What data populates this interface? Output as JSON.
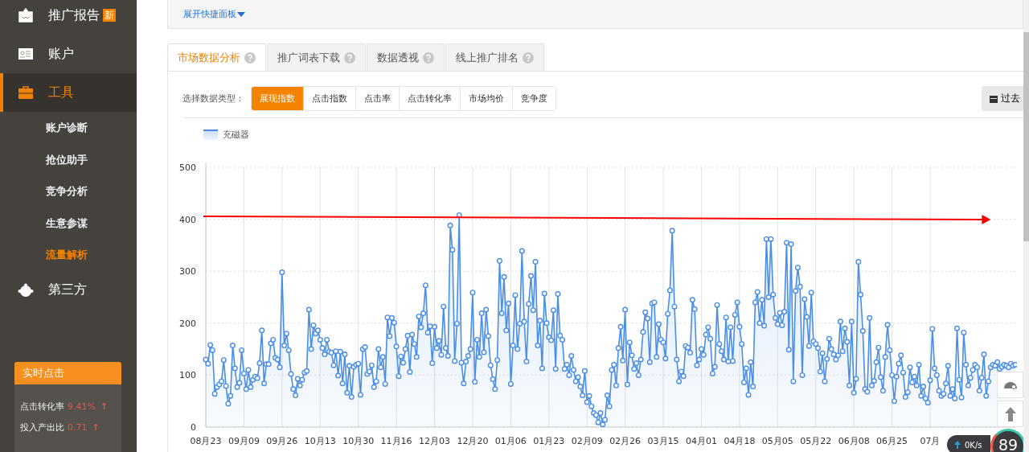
{
  "sidebar": {
    "items": [
      {
        "label": "推广报告",
        "badge": "新",
        "selected": false
      },
      {
        "label": "账户",
        "selected": false
      },
      {
        "label": "工具",
        "selected": true,
        "children": [
          {
            "label": "账户诊断",
            "selected": false
          },
          {
            "label": "抢位助手",
            "selected": false
          },
          {
            "label": "竞争分析",
            "selected": false
          },
          {
            "label": "生意参谋",
            "selected": false
          },
          {
            "label": "流量解析",
            "selected": true
          }
        ]
      },
      {
        "label": "第三方",
        "selected": false
      }
    ],
    "realtime": {
      "title": "实时点击",
      "rows": [
        {
          "label": "点击转化率",
          "value": "9.41%",
          "trend": "↑"
        },
        {
          "label": "投入产出比",
          "value": "0.71",
          "trend": "↑"
        }
      ]
    }
  },
  "quick_panel": {
    "label": "展开快捷面板"
  },
  "tabs": [
    {
      "label": "市场数据分析",
      "selected": true
    },
    {
      "label": "推广词表下载",
      "selected": false
    },
    {
      "label": "数据透视",
      "selected": false
    },
    {
      "label": "线上推广排名",
      "selected": false
    }
  ],
  "data_type": {
    "label": "选择数据类型：",
    "options": [
      {
        "label": "展现指数",
        "selected": true
      },
      {
        "label": "点击指数",
        "selected": false
      },
      {
        "label": "点击率",
        "selected": false
      },
      {
        "label": "点击转化率",
        "selected": false
      },
      {
        "label": "市场均价",
        "selected": false
      },
      {
        "label": "竞争度",
        "selected": false
      }
    ]
  },
  "date_button": {
    "label": "过去"
  },
  "chart": {
    "chart_data": {
      "type": "area",
      "grid": true,
      "ylim": [
        0,
        500
      ],
      "yticks": [
        0,
        100,
        200,
        300,
        400,
        500
      ],
      "categories": [
        "08月23",
        null,
        null,
        null,
        null,
        null,
        null,
        null,
        null,
        null,
        null,
        null,
        null,
        null,
        null,
        null,
        null,
        "09月09",
        null,
        null,
        null,
        null,
        null,
        null,
        null,
        null,
        null,
        null,
        null,
        null,
        null,
        null,
        null,
        null,
        "09月26",
        null,
        null,
        null,
        null,
        null,
        null,
        null,
        null,
        null,
        null,
        null,
        null,
        null,
        null,
        null,
        null,
        "10月13",
        null,
        null,
        null,
        null,
        null,
        null,
        null,
        null,
        null,
        null,
        null,
        null,
        null,
        null,
        null,
        null,
        "10月30",
        null,
        null,
        null,
        null,
        null,
        null,
        null,
        null,
        null,
        null,
        null,
        null,
        null,
        null,
        null,
        null,
        "11月16",
        null,
        null,
        null,
        null,
        null,
        null,
        null,
        null,
        null,
        null,
        null,
        null,
        null,
        null,
        null,
        null,
        "12月03",
        null,
        null,
        null,
        null,
        null,
        null,
        null,
        null,
        null,
        null,
        null,
        null,
        null,
        null,
        null,
        null,
        "12月20",
        null,
        null,
        null,
        null,
        null,
        null,
        null,
        null,
        null,
        null,
        null,
        null,
        null,
        null,
        null,
        null,
        "01月06",
        null,
        null,
        null,
        null,
        null,
        null,
        null,
        null,
        null,
        null,
        null,
        null,
        null,
        null,
        null,
        null,
        "01月23",
        null,
        null,
        null,
        null,
        null,
        null,
        null,
        null,
        null,
        null,
        null,
        null,
        null,
        null,
        null,
        null,
        "02月09",
        null,
        null,
        null,
        null,
        null,
        null,
        null,
        null,
        null,
        null,
        null,
        null,
        null,
        null,
        null,
        null,
        "02月26",
        null,
        null,
        null,
        null,
        null,
        null,
        null,
        null,
        null,
        null,
        null,
        null,
        null,
        null,
        null,
        null,
        "03月15",
        null,
        null,
        null,
        null,
        null,
        null,
        null,
        null,
        null,
        null,
        null,
        null,
        null,
        null,
        null,
        null,
        "04月01",
        null,
        null,
        null,
        null,
        null,
        null,
        null,
        null,
        null,
        null,
        null,
        null,
        null,
        null,
        null,
        null,
        "04月18",
        null,
        null,
        null,
        null,
        null,
        null,
        null,
        null,
        null,
        null,
        null,
        null,
        null,
        null,
        null,
        null,
        "05月05",
        null,
        null,
        null,
        null,
        null,
        null,
        null,
        null,
        null,
        null,
        null,
        null,
        null,
        null,
        null,
        null,
        "05月22",
        null,
        null,
        null,
        null,
        null,
        null,
        null,
        null,
        null,
        null,
        null,
        null,
        null,
        null,
        null,
        null,
        "06月08",
        null,
        null,
        null,
        null,
        null,
        null,
        null,
        null,
        null,
        null,
        null,
        null,
        null,
        null,
        null,
        null,
        "06月25",
        null,
        null,
        null,
        null,
        null,
        null,
        null,
        null,
        null,
        null,
        null,
        null,
        null,
        null,
        null,
        null,
        "07月",
        null,
        null,
        null,
        null,
        null,
        null,
        null,
        null,
        null,
        null,
        null,
        null,
        null,
        null,
        null,
        null,
        null,
        null,
        null,
        null,
        null,
        null,
        null,
        null,
        null,
        null,
        null,
        null,
        null,
        null,
        null,
        null,
        null,
        null,
        null,
        null,
        null,
        null
      ],
      "series": [
        {
          "name": "充磁器",
          "color": "#4a8ee6",
          "values": [
            130,
            122,
            158,
            148,
            64,
            77,
            82,
            88,
            129,
            79,
            45,
            60,
            157,
            113,
            77,
            85,
            148,
            103,
            73,
            110,
            77,
            91,
            97,
            94,
            123,
            186,
            84,
            121,
            121,
            161,
            168,
            133,
            130,
            115,
            298,
            157,
            180,
            148,
            102,
            73,
            61,
            93,
            80,
            91,
            105,
            108,
            226,
            150,
            196,
            180,
            186,
            168,
            152,
            140,
            168,
            145,
            143,
            119,
            146,
            99,
            145,
            84,
            140,
            66,
            118,
            58,
            116,
            120,
            122,
            62,
            150,
            154,
            102,
            107,
            119,
            77,
            88,
            150,
            115,
            135,
            83,
            211,
            175,
            210,
            201,
            155,
            98,
            136,
            124,
            150,
            176,
            106,
            178,
            160,
            135,
            213,
            192,
            219,
            273,
            182,
            194,
            123,
            193,
            152,
            166,
            139,
            232,
            152,
            137,
            388,
            341,
            127,
            199,
            408,
            124,
            84,
            126,
            137,
            150,
            259,
            87,
            168,
            135,
            219,
            144,
            226,
            175,
            119,
            92,
            73,
            129,
            320,
            219,
            289,
            186,
            238,
            83,
            157,
            254,
            150,
            199,
            339,
            203,
            126,
            237,
            291,
            225,
            318,
            157,
            205,
            113,
            257,
            200,
            173,
            167,
            225,
            112,
            256,
            176,
            168,
            112,
            120,
            100,
            137,
            110,
            88,
            96,
            78,
            61,
            108,
            48,
            60,
            40,
            27,
            23,
            9,
            27,
            5,
            14,
            61,
            40,
            110,
            120,
            80,
            152,
            193,
            128,
            226,
            82,
            163,
            138,
            112,
            123,
            100,
            130,
            183,
            221,
            209,
            125,
            238,
            240,
            135,
            198,
            168,
            163,
            132,
            218,
            263,
            378,
            232,
            130,
            88,
            107,
            98,
            156,
            153,
            143,
            245,
            227,
            119,
            130,
            150,
            139,
            178,
            192,
            170,
            103,
            116,
            235,
            160,
            146,
            130,
            211,
            126,
            192,
            127,
            216,
            240,
            193,
            160,
            86,
            113,
            62,
            125,
            78,
            240,
            260,
            200,
            245,
            195,
            362,
            250,
            362,
            255,
            210,
            198,
            220,
            196,
            222,
            355,
            149,
            352,
            88,
            262,
            307,
            270,
            100,
            246,
            212,
            156,
            259,
            165,
            160,
            152,
            107,
            142,
            88,
            131,
            170,
            150,
            140,
            130,
            138,
            203,
            146,
            190,
            164,
            80,
            203,
            66,
            93,
            318,
            255,
            185,
            73,
            68,
            210,
            80,
            89,
            125,
            153,
            96,
            70,
            135,
            197,
            148,
            100,
            50,
            97,
            122,
            138,
            105,
            58,
            67,
            115,
            86,
            97,
            80,
            120,
            60,
            78,
            55,
            47,
            90,
            189,
            113,
            100,
            70,
            60,
            64,
            84,
            118,
            60,
            73,
            55,
            190,
            91,
            57,
            182,
            120,
            80,
            95,
            110,
            120,
            115,
            70,
            95,
            140,
            60,
            88,
            115,
            120,
            118,
            125,
            112,
            116,
            120,
            118,
            115,
            122,
            118,
            120
          ]
        }
      ]
    }
  },
  "speed_widget": {
    "speed": "0K/s",
    "score": "89"
  }
}
